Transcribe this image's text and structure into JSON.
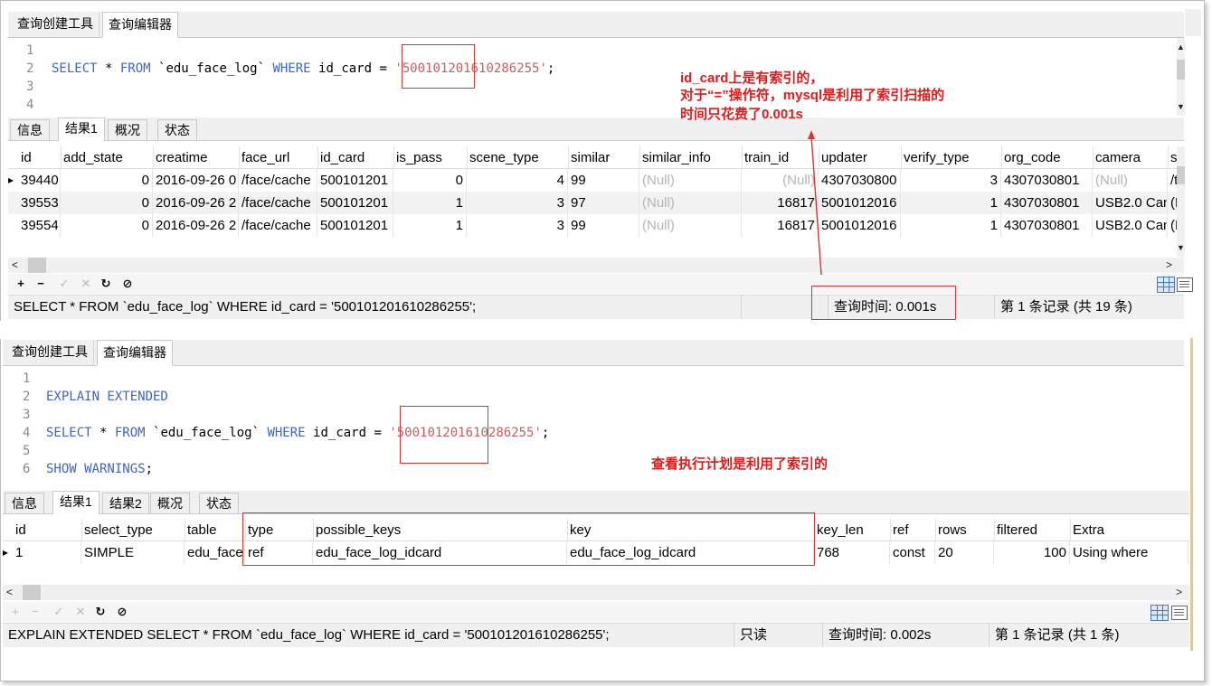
{
  "top": {
    "tabs": [
      "查询创建工具",
      "查询编辑器"
    ],
    "code_lines": [
      "1",
      "2",
      "3",
      "4"
    ],
    "sql": {
      "select": "SELECT",
      "star": " * ",
      "from": "FROM",
      "table": " `edu_face_log` ",
      "where": "WHERE",
      "cond": " id_card = ",
      "value": "'500101201610286255'",
      "end": ";"
    },
    "result_tabs": [
      "信息",
      "结果1",
      "概况",
      "状态"
    ],
    "columns": [
      "id",
      "add_state",
      "creatime",
      "face_url",
      "id_card",
      "is_pass",
      "scene_type",
      "similar",
      "similar_info",
      "train_id",
      "updater",
      "verify_type",
      "org_code",
      "camera",
      "s"
    ],
    "rows": [
      [
        "39440",
        "0",
        "2016-09-26 0",
        "/face/cache",
        "500101201",
        "0",
        "4",
        "99",
        "(Null)",
        "(Null)",
        "4307030800",
        "3",
        "4307030801",
        "(Null)",
        "/t"
      ],
      [
        "39553",
        "0",
        "2016-09-26 2",
        "/face/cache",
        "500101201",
        "1",
        "3",
        "97",
        "(Null)",
        "16817",
        "5001012016",
        "1",
        "4307030801",
        "USB2.0 Can",
        "(N"
      ],
      [
        "39554",
        "0",
        "2016-09-26 2",
        "/face/cache",
        "500101201",
        "1",
        "3",
        "99",
        "(Null)",
        "16817",
        "5001012016",
        "1",
        "4307030801",
        "USB2.0 Can",
        "(N"
      ]
    ],
    "status": {
      "sql": "SELECT * FROM `edu_face_log` WHERE id_card = '500101201610286255';",
      "time": "查询时间: 0.001s",
      "records": "第 1 条记录 (共 19 条)"
    }
  },
  "bottom": {
    "tabs": [
      "查询创建工具",
      "查询编辑器"
    ],
    "code_lines": [
      "1",
      "2",
      "3",
      "4",
      "5",
      "6"
    ],
    "sql": {
      "explain": "EXPLAIN EXTENDED",
      "select": "SELECT",
      "star": " * ",
      "from": "FROM",
      "table": " `edu_face_log` ",
      "where": "WHERE",
      "cond": " id_card = ",
      "value": "'500101201610286255'",
      "end": ";",
      "show": "SHOW WARNINGS",
      "end2": ";"
    },
    "result_tabs": [
      "信息",
      "结果1",
      "结果2",
      "概况",
      "状态"
    ],
    "columns": [
      "id",
      "select_type",
      "table",
      "type",
      "possible_keys",
      "key",
      "key_len",
      "ref",
      "rows",
      "filtered",
      "Extra"
    ],
    "rows": [
      [
        "1",
        "SIMPLE",
        "edu_face",
        "ref",
        "edu_face_log_idcard",
        "edu_face_log_idcard",
        "768",
        "const",
        "20",
        "100",
        "Using where"
      ]
    ],
    "status": {
      "sql": "EXPLAIN EXTENDED  SELECT * FROM `edu_face_log` WHERE id_card = '500101201610286255';",
      "readonly": "只读",
      "time": "查询时间: 0.002s",
      "records": "第 1 条记录 (共 1 条)"
    }
  },
  "annotations": {
    "note1_line1": "id_card上是有索引的，",
    "note1_line2": "对于“=”操作符，mysql是利用了索引扫描的",
    "note1_line3": "时间只花费了0.001s",
    "note2": "查看执行计划是利用了索引的"
  },
  "colors": {
    "annotation": "#e21a1a",
    "keyword": "#3d64c8",
    "string": "#c06060"
  }
}
